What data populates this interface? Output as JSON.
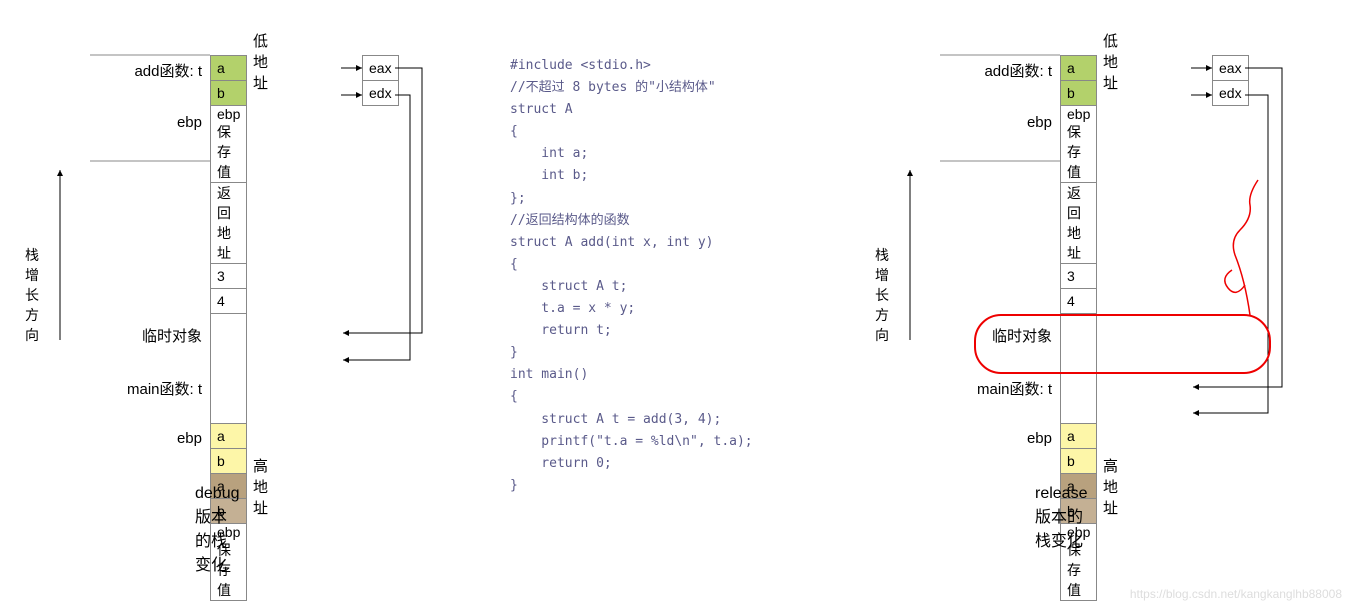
{
  "stack": {
    "addr_low": "低地址",
    "addr_high": "高地址",
    "add_func": "add函数:  t",
    "ebp_label": "ebp",
    "temp_obj": "临时对象",
    "main_func": "main函数:  t",
    "growth": "栈增长方向",
    "cells": {
      "a1": "a",
      "b1": "b",
      "ebp_save": "ebp 保存值",
      "ret_addr": "返回地址",
      "three": "3",
      "four": "4",
      "a2": "a",
      "b2": "b",
      "a3": "a",
      "b3": "b",
      "ebp_save2": "ebp 保存值"
    },
    "reg": {
      "eax": "eax",
      "edx": "edx"
    }
  },
  "titles": {
    "debug": "debug版本的栈变化",
    "release": "release版本的栈变化"
  },
  "code": "#include <stdio.h>\n//不超过 8 bytes 的\"小结构体\"\nstruct A\n{\n    int a;\n    int b;\n};\n//返回结构体的函数\nstruct A add(int x, int y)\n{\n    struct A t;\n    t.a = x * y;\n    return t;\n}\nint main()\n{\n    struct A t = add(3, 4);\n    printf(\"t.a = %ld\\n\", t.a);\n    return 0;\n}",
  "watermark": "https://blog.csdn.net/kangkanglhb88008"
}
